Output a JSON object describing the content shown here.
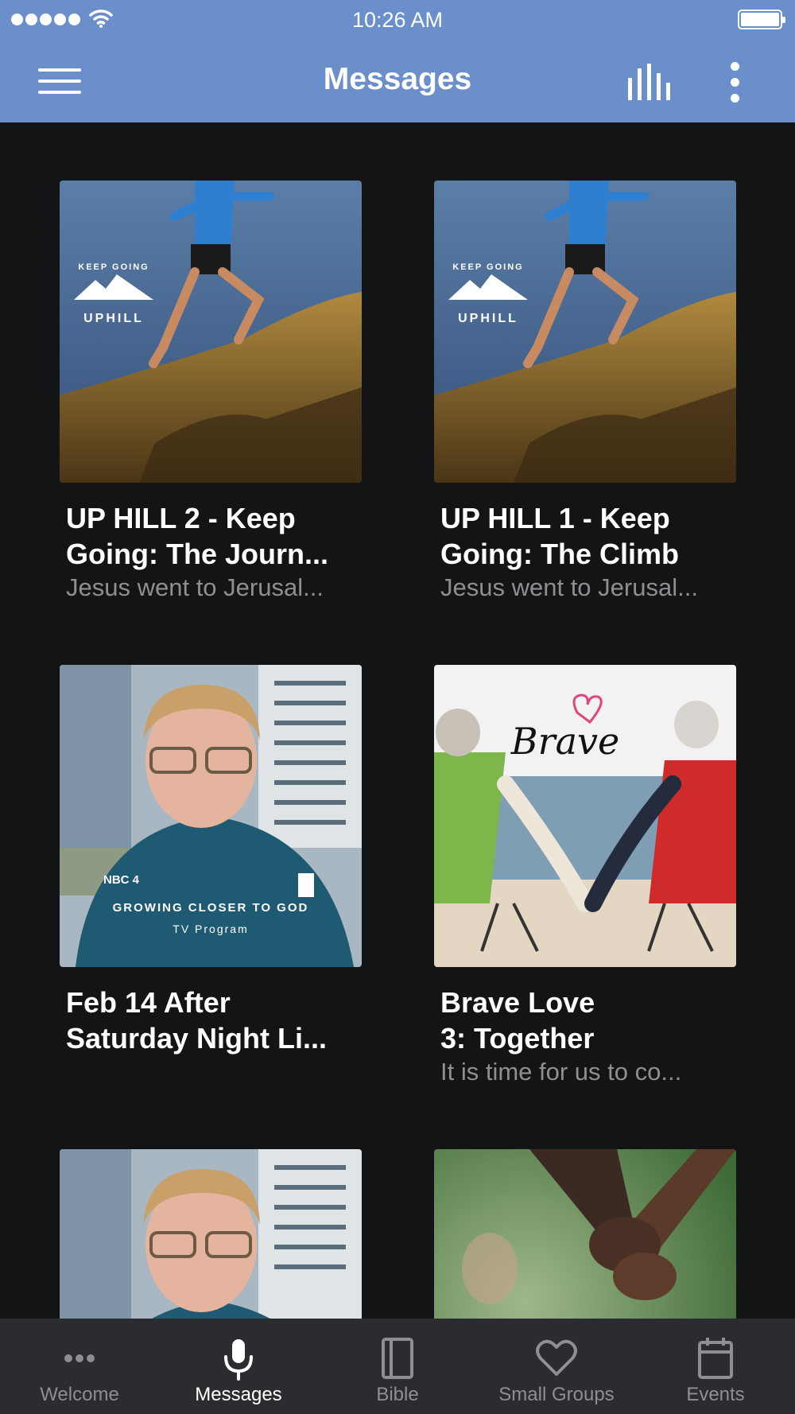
{
  "status_bar": {
    "time": "10:26 AM"
  },
  "header": {
    "title": "Messages"
  },
  "cards": [
    {
      "title_line1": "UP HILL 2 - Keep",
      "title_line2": "Going: The Journ...",
      "subtitle": "Jesus went to Jerusal...",
      "art_lines": [
        "KEEP GOING",
        "UPHILL"
      ]
    },
    {
      "title_line1": "UP HILL 1 - Keep",
      "title_line2": "Going: The Climb",
      "subtitle": "Jesus went to Jerusal...",
      "art_lines": [
        "KEEP GOING",
        "UPHILL"
      ]
    },
    {
      "title_line1": "Feb 14 After",
      "title_line2": "Saturday Night Li...",
      "subtitle": "",
      "art_lines": [
        "NBC 4",
        "GROWING CLOSER TO GOD",
        "TV Program"
      ]
    },
    {
      "title_line1": "Brave Love",
      "title_line2": "3: Together",
      "subtitle": "It is time for us to co...",
      "art_lines": [
        "Brave"
      ]
    },
    {
      "title_line1": "",
      "title_line2": "",
      "subtitle": ""
    },
    {
      "title_line1": "",
      "title_line2": "",
      "subtitle": ""
    }
  ],
  "tabs": [
    {
      "label": "Welcome",
      "icon": "ellipsis-icon"
    },
    {
      "label": "Messages",
      "icon": "microphone-icon",
      "active": true
    },
    {
      "label": "Bible",
      "icon": "book-icon"
    },
    {
      "label": "Small Groups",
      "icon": "heart-icon"
    },
    {
      "label": "Events",
      "icon": "calendar-icon"
    }
  ],
  "colors": {
    "header_bg": "#6a8fcb",
    "page_bg": "#131416",
    "tab_bar_bg": "#2b2c2f",
    "muted_text": "#8e8f93"
  }
}
